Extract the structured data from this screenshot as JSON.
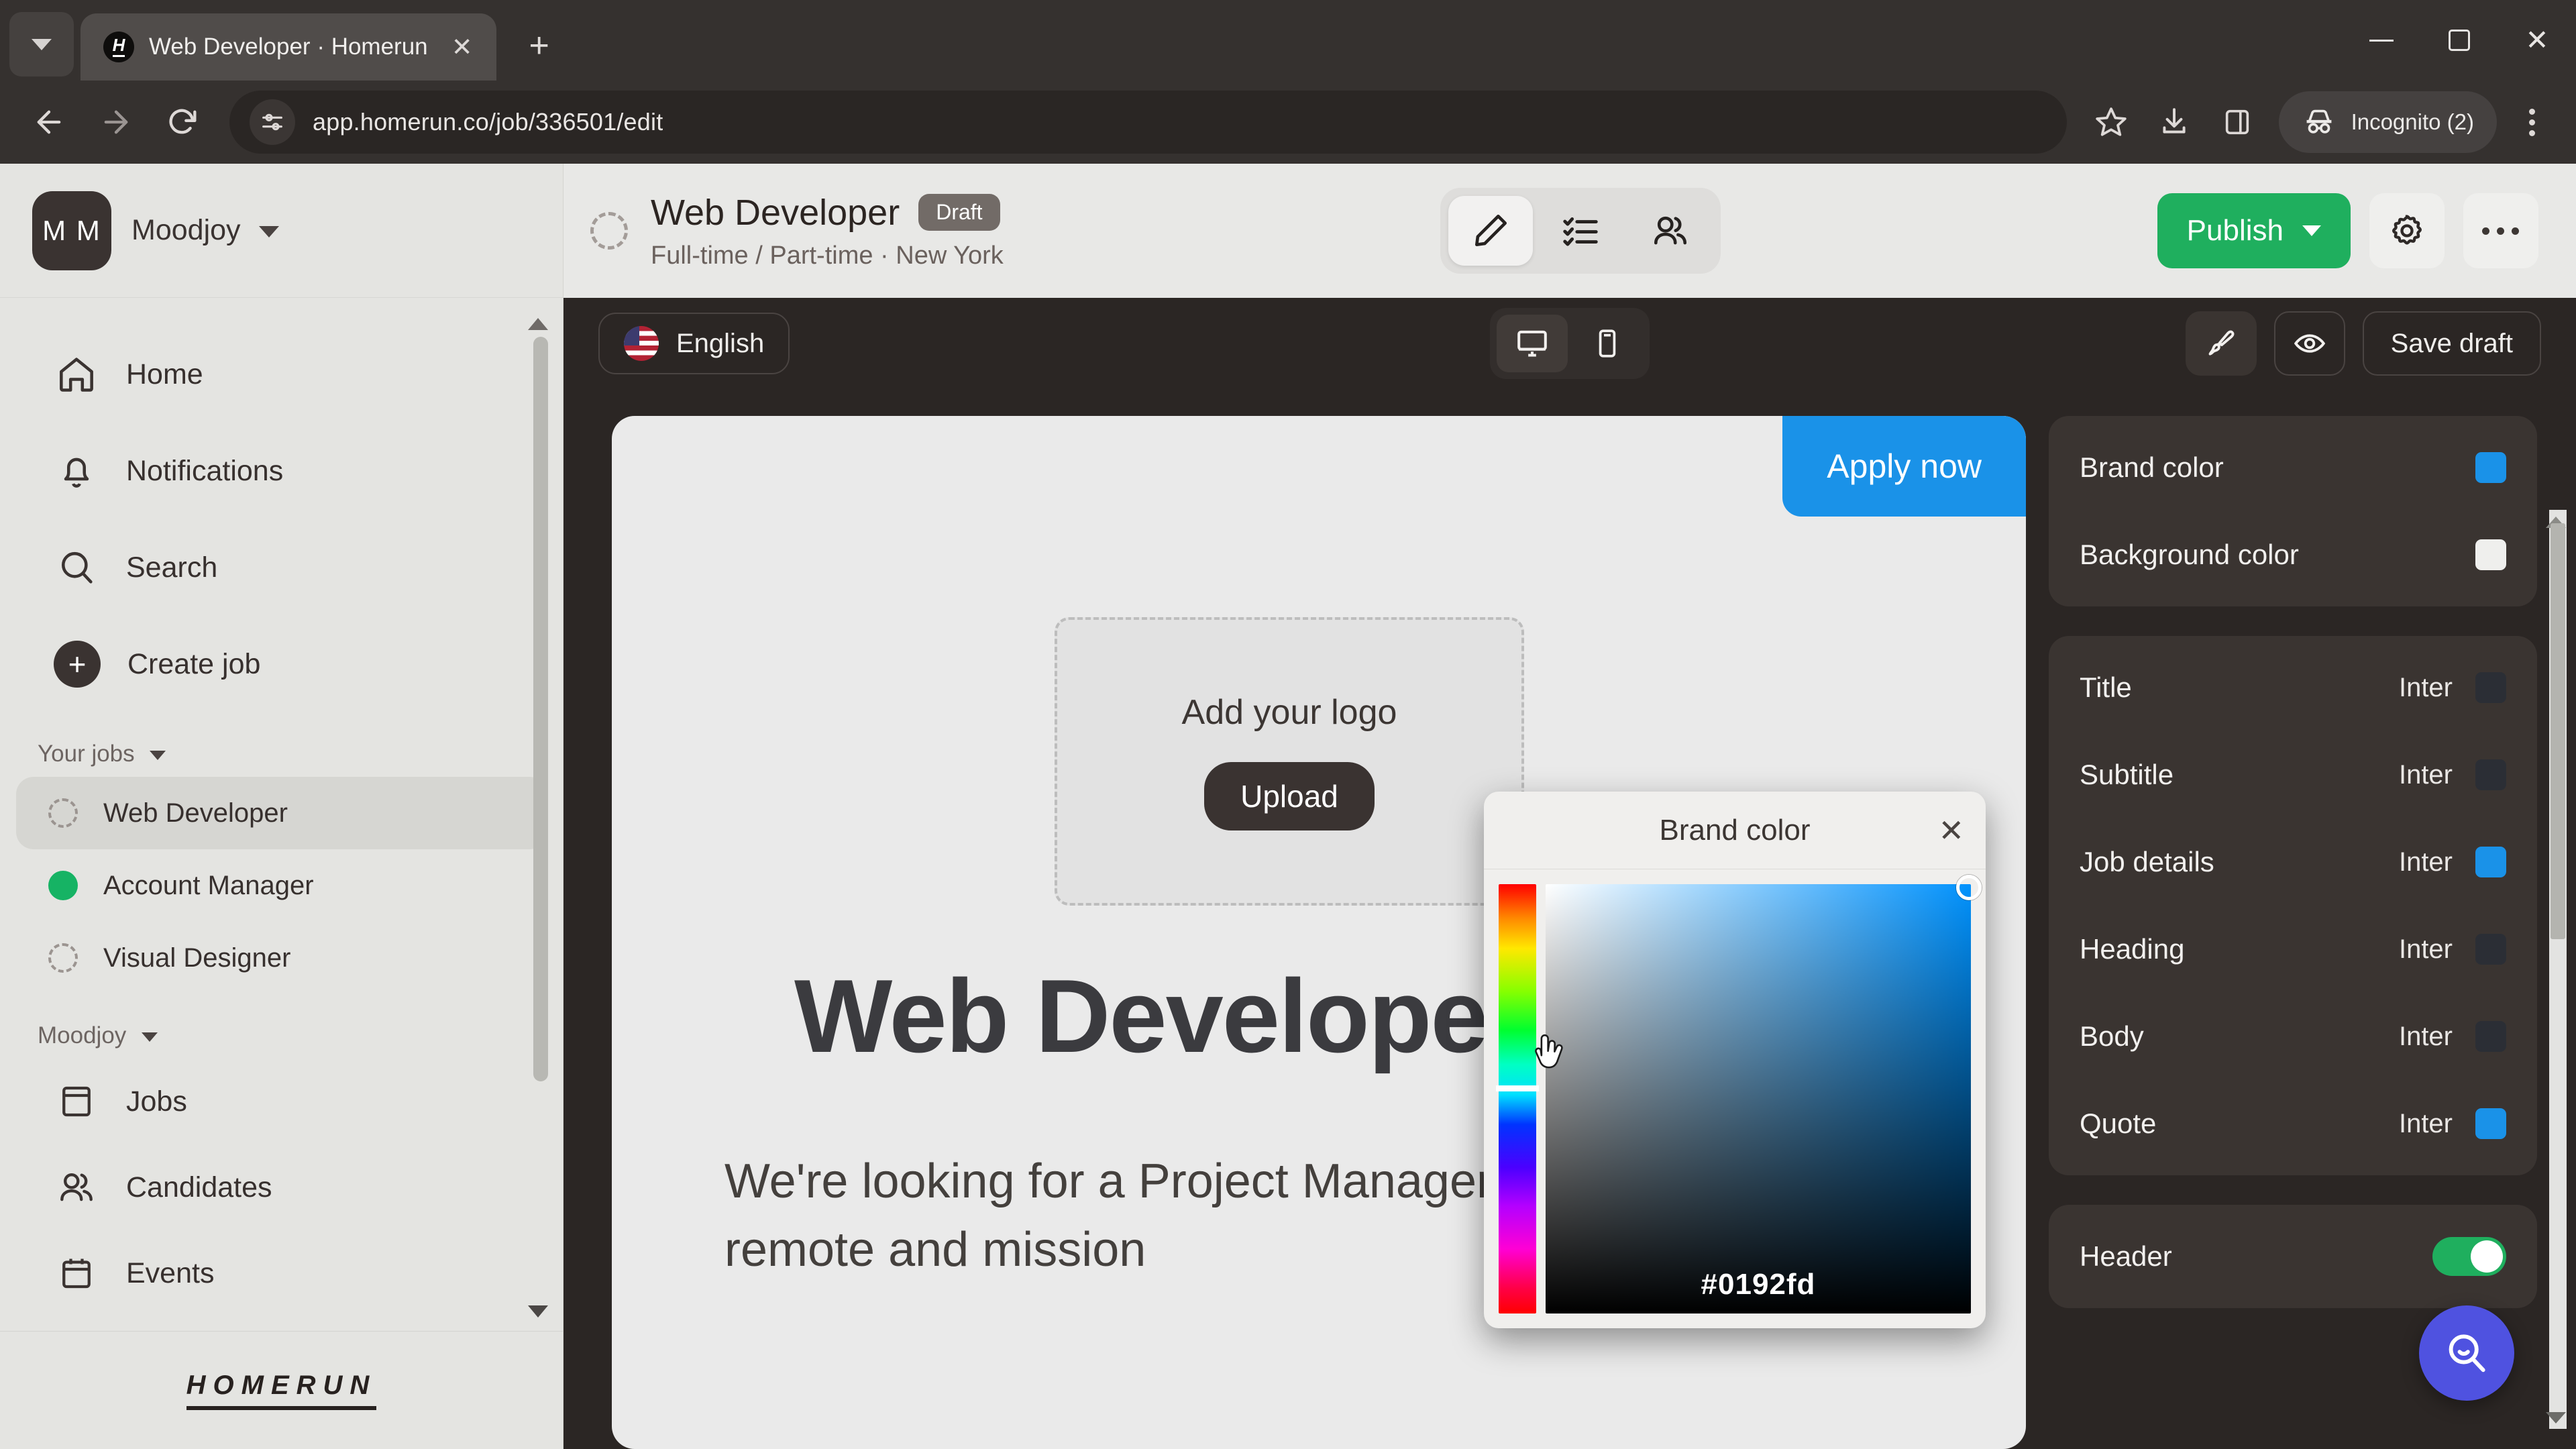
{
  "browser": {
    "tab": {
      "title": "Web Developer · Homerun",
      "favicon_letter": "H"
    },
    "new_tab_label": "+",
    "close_tab_label": "✕",
    "url": "app.homerun.co/job/336501/edit",
    "profile_label": "Incognito (2)",
    "icons": {
      "tab_search": "chevron-down-icon",
      "back": "back-arrow-icon",
      "forward": "forward-arrow-icon",
      "reload": "reload-icon",
      "site_info": "site-settings-icon",
      "bookmark": "star-icon",
      "downloads": "download-icon",
      "side_panel": "side-panel-icon",
      "incognito": "incognito-icon",
      "menu": "kebab-menu-icon"
    },
    "window": {
      "minimize": "minimize-icon",
      "maximize": "maximize-icon",
      "close": "close-icon"
    }
  },
  "sidebar": {
    "org": {
      "initials": "M M",
      "name": "Moodjoy"
    },
    "nav": [
      {
        "label": "Home",
        "icon": "home-icon"
      },
      {
        "label": "Notifications",
        "icon": "bell-icon"
      },
      {
        "label": "Search",
        "icon": "search-icon"
      },
      {
        "label": "Create job",
        "icon": "plus-circle-icon"
      }
    ],
    "your_jobs_label": "Your jobs",
    "jobs": [
      {
        "label": "Web Developer",
        "status": "draft",
        "active": true
      },
      {
        "label": "Account Manager",
        "status": "published",
        "active": false
      },
      {
        "label": "Visual Designer",
        "status": "draft",
        "active": false
      }
    ],
    "workspace_label": "Moodjoy",
    "workspace_items": [
      {
        "label": "Jobs",
        "icon": "jobs-icon"
      },
      {
        "label": "Candidates",
        "icon": "candidates-icon"
      },
      {
        "label": "Events",
        "icon": "calendar-icon"
      }
    ],
    "footer_logo": "HOMERUN"
  },
  "job_header": {
    "title": "Web Developer",
    "badge": "Draft",
    "subtitle": "Full-time / Part-time · New York",
    "tabs": [
      {
        "name": "edit-tab",
        "icon": "pencil-icon",
        "active": true
      },
      {
        "name": "checklist-tab",
        "icon": "checklist-icon",
        "active": false
      },
      {
        "name": "candidates-tab",
        "icon": "people-icon",
        "active": false
      }
    ],
    "publish_label": "Publish",
    "settings_icon": "gear-icon",
    "more_icon": "more-horizontal-icon"
  },
  "editor_toolbar": {
    "language": "English",
    "language_flag": "us-flag-icon",
    "devices": [
      {
        "name": "desktop",
        "icon": "desktop-icon",
        "active": true
      },
      {
        "name": "mobile",
        "icon": "mobile-icon",
        "active": false
      }
    ],
    "design_icon": "paintbrush-icon",
    "preview_icon": "eye-icon",
    "save_draft_label": "Save draft"
  },
  "canvas": {
    "apply_label": "Apply now",
    "logo_placeholder": "Add your logo",
    "upload_label": "Upload",
    "heading": "Web Developer",
    "body": "We're looking for a Project Manager to join our fully remote and mission"
  },
  "color_picker": {
    "title": "Brand color",
    "close_label": "✕",
    "hex": "#0192fd"
  },
  "rail": {
    "colors": [
      {
        "label": "Brand color",
        "swatch": "#1a92e8"
      },
      {
        "label": "Background color",
        "swatch": "#efefed"
      }
    ],
    "typography_header_font": "Inter",
    "typography": [
      {
        "label": "Title",
        "font": "Inter",
        "swatch": "#2b2e35"
      },
      {
        "label": "Subtitle",
        "font": "Inter",
        "swatch": "#2b2e35"
      },
      {
        "label": "Job details",
        "font": "Inter",
        "swatch": "#1a92e8"
      },
      {
        "label": "Heading",
        "font": "Inter",
        "swatch": "#2b2e35"
      },
      {
        "label": "Body",
        "font": "Inter",
        "swatch": "#2b2e35"
      },
      {
        "label": "Quote",
        "font": "Inter",
        "swatch": "#1a92e8"
      }
    ],
    "sections": [
      {
        "label": "Header",
        "toggle": true
      }
    ],
    "fab_icon": "search-icon"
  },
  "theme": {
    "brand": "#0192fd",
    "publish_green": "#1faf5e",
    "dark_panel": "#3a3431",
    "editor_bg": "#2b2624"
  }
}
